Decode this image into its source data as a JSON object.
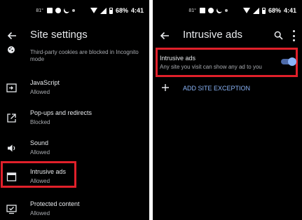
{
  "left_screen": {
    "status": {
      "temp": "81°",
      "battery": "68%",
      "time": "4:41"
    },
    "title": "Site settings",
    "partial_item": {
      "text": "Third-party cookies are blocked in Incognito mode",
      "icon": "cookie-icon"
    },
    "items": [
      {
        "label": "JavaScript",
        "sub": "Allowed",
        "icon": "javascript-icon"
      },
      {
        "label": "Pop-ups and redirects",
        "sub": "Blocked",
        "icon": "external-link-icon"
      },
      {
        "label": "Sound",
        "sub": "Allowed",
        "icon": "speaker-icon"
      },
      {
        "label": "Intrusive ads",
        "sub": "Allowed",
        "icon": "window-icon"
      },
      {
        "label": "Protected content",
        "sub": "Allowed",
        "icon": "protected-content-icon"
      }
    ]
  },
  "right_screen": {
    "status": {
      "temp": "81°",
      "battery": "68%",
      "time": "4:41"
    },
    "title": "Intrusive ads",
    "setting": {
      "label": "Intrusive ads",
      "sub": "Any site you visit can show any ad to you",
      "enabled": true
    },
    "add_exception": "ADD SITE EXCEPTION"
  },
  "colors": {
    "highlight": "#e0202a",
    "accent": "#8ab4f8",
    "background": "#000000"
  }
}
